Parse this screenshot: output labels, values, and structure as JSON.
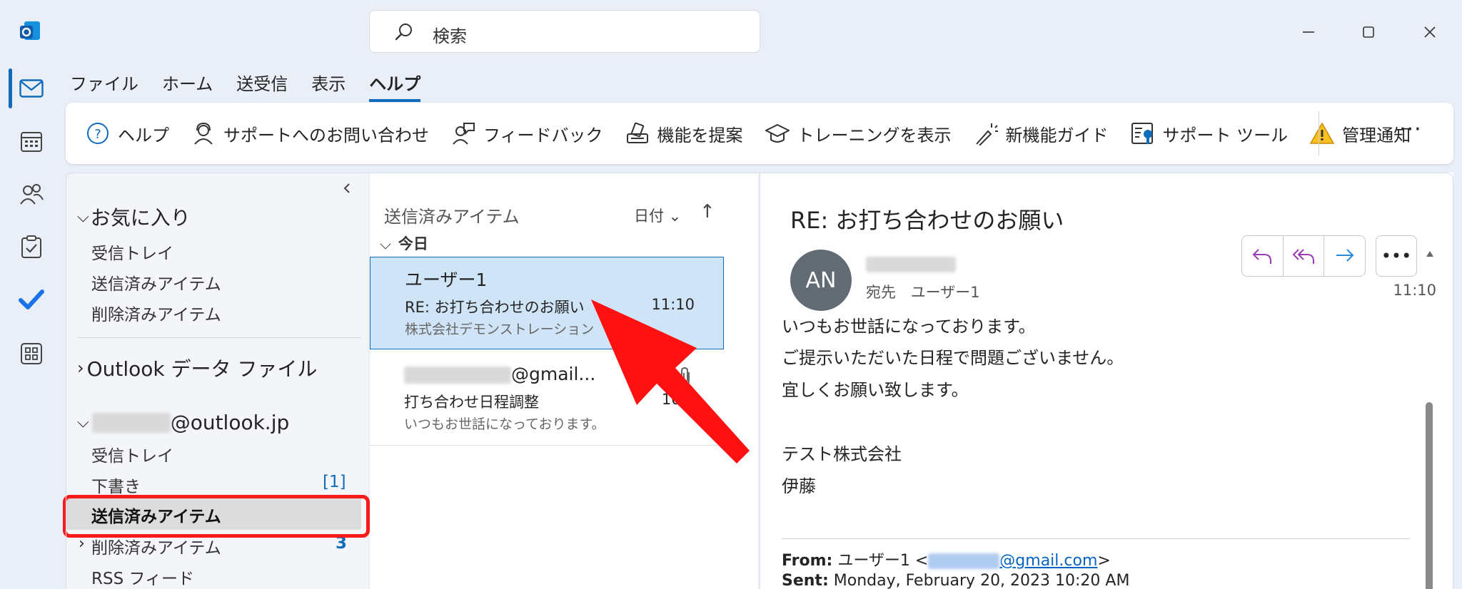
{
  "search": {
    "placeholder": "検索"
  },
  "window_controls": {
    "minimize": "—",
    "maximize": "☐",
    "close": "✕"
  },
  "menu": {
    "tabs": [
      {
        "label": "ファイル"
      },
      {
        "label": "ホーム"
      },
      {
        "label": "送受信"
      },
      {
        "label": "表示"
      },
      {
        "label": "ヘルプ",
        "active": true
      }
    ]
  },
  "ribbon": {
    "items": [
      {
        "label": "ヘルプ",
        "icon": "help-icon"
      },
      {
        "label": "サポートへのお問い合わせ",
        "icon": "contact-support-icon"
      },
      {
        "label": "フィードバック",
        "icon": "feedback-icon"
      },
      {
        "label": "機能を提案",
        "icon": "suggest-feature-icon"
      },
      {
        "label": "トレーニングを表示",
        "icon": "training-icon"
      },
      {
        "label": "新機能ガイド",
        "icon": "whats-new-icon"
      },
      {
        "label": "サポート ツール",
        "icon": "support-tools-icon"
      },
      {
        "label": "管理通知",
        "icon": "warning-icon"
      }
    ],
    "more": "···"
  },
  "folders": {
    "favorites": {
      "label": "お気に入り",
      "items": [
        "受信トレイ",
        "送信済みアイテム",
        "削除済みアイテム"
      ]
    },
    "data_file": {
      "label": "Outlook データ ファイル"
    },
    "account": {
      "domain": "@outlook.jp",
      "items": [
        {
          "label": "受信トレイ"
        },
        {
          "label": "下書き",
          "count": "[1]"
        },
        {
          "label": "送信済みアイテム",
          "selected": true
        },
        {
          "label": "削除済みアイテム",
          "count": "3"
        },
        {
          "label": "RSS フィード"
        }
      ]
    }
  },
  "message_list": {
    "title": "送信済みアイテム",
    "sort_label": "日付 ⌄",
    "sort_direction": "↑",
    "group": "今日",
    "messages": [
      {
        "sender": "ユーザー1",
        "subject": "RE: お打ち合わせのお願い",
        "time": "11:10",
        "preview": "株式会社デモンストレーション",
        "selected": true
      },
      {
        "sender_suffix": "@gmail...",
        "subject": "打ち合わせ日程調整",
        "time": "10:0",
        "preview": "いつもお世話になっております。"
      }
    ]
  },
  "reading_pane": {
    "subject": "RE: お打ち合わせのお願い",
    "avatar_initials": "AN",
    "to_label": "宛先",
    "to_value": "ユーザー1",
    "time": "11:10",
    "body": [
      "いつもお世話になっております。",
      "ご提示いただいた日程で問題ございません。",
      "宜しくお願い致します。",
      "テスト株式会社",
      "伊藤"
    ],
    "quoted": {
      "from_label": "From:",
      "from_name": "ユーザー1 <",
      "from_email": "@gmail.com",
      "from_close": ">",
      "sent_label": "Sent:",
      "sent_value": "Monday, February 20, 2023 10:20 AM"
    }
  },
  "colors": {
    "accent": "#0f6cbd",
    "highlight_red": "#ff1a1a",
    "selected_msg_bg": "#cfe4f7",
    "avatar_bg": "#626a73"
  }
}
